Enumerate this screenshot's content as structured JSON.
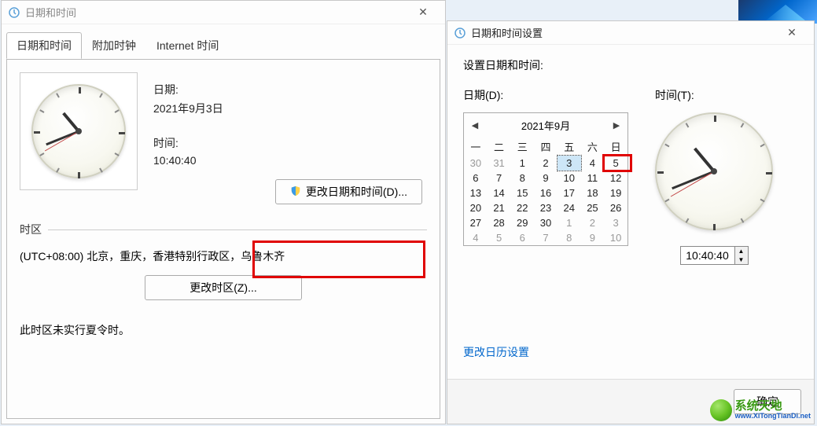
{
  "left": {
    "title": "日期和时间",
    "tabs": [
      "日期和时间",
      "附加时钟",
      "Internet 时间"
    ],
    "date_label": "日期:",
    "date_value": "2021年9月3日",
    "time_label": "时间:",
    "time_value": "10:40:40",
    "change_dt_btn": "更改日期和时间(D)...",
    "tz_header": "时区",
    "tz_value": "(UTC+08:00) 北京，重庆，香港特别行政区，乌鲁木齐",
    "change_tz_btn": "更改时区(Z)...",
    "dst_note": "此时区未实行夏令时。"
  },
  "right": {
    "title": "日期和时间设置",
    "prompt": "设置日期和时间:",
    "date_label": "日期(D):",
    "time_label": "时间(T):",
    "month_year": "2021年9月",
    "dow": [
      "一",
      "二",
      "三",
      "四",
      "五",
      "六",
      "日"
    ],
    "days": [
      {
        "n": "30",
        "other": true
      },
      {
        "n": "31",
        "other": true
      },
      {
        "n": "1"
      },
      {
        "n": "2"
      },
      {
        "n": "3",
        "selected": true
      },
      {
        "n": "4"
      },
      {
        "n": "5",
        "highlight": true
      },
      {
        "n": "6"
      },
      {
        "n": "7"
      },
      {
        "n": "8"
      },
      {
        "n": "9"
      },
      {
        "n": "10"
      },
      {
        "n": "11"
      },
      {
        "n": "12"
      },
      {
        "n": "13"
      },
      {
        "n": "14"
      },
      {
        "n": "15"
      },
      {
        "n": "16"
      },
      {
        "n": "17"
      },
      {
        "n": "18"
      },
      {
        "n": "19"
      },
      {
        "n": "20"
      },
      {
        "n": "21"
      },
      {
        "n": "22"
      },
      {
        "n": "23"
      },
      {
        "n": "24"
      },
      {
        "n": "25"
      },
      {
        "n": "26"
      },
      {
        "n": "27"
      },
      {
        "n": "28"
      },
      {
        "n": "29"
      },
      {
        "n": "30"
      },
      {
        "n": "1",
        "other": true
      },
      {
        "n": "2",
        "other": true
      },
      {
        "n": "3",
        "other": true
      },
      {
        "n": "4",
        "other": true
      },
      {
        "n": "5",
        "other": true
      },
      {
        "n": "6",
        "other": true
      },
      {
        "n": "7",
        "other": true
      },
      {
        "n": "8",
        "other": true
      },
      {
        "n": "9",
        "other": true
      },
      {
        "n": "10",
        "other": true
      }
    ],
    "time_value": "10:40:40",
    "link": "更改日历设置",
    "ok_btn": "确定"
  },
  "watermark": {
    "line1": "系统天地",
    "line2": "www.XiTongTianDi.net"
  }
}
